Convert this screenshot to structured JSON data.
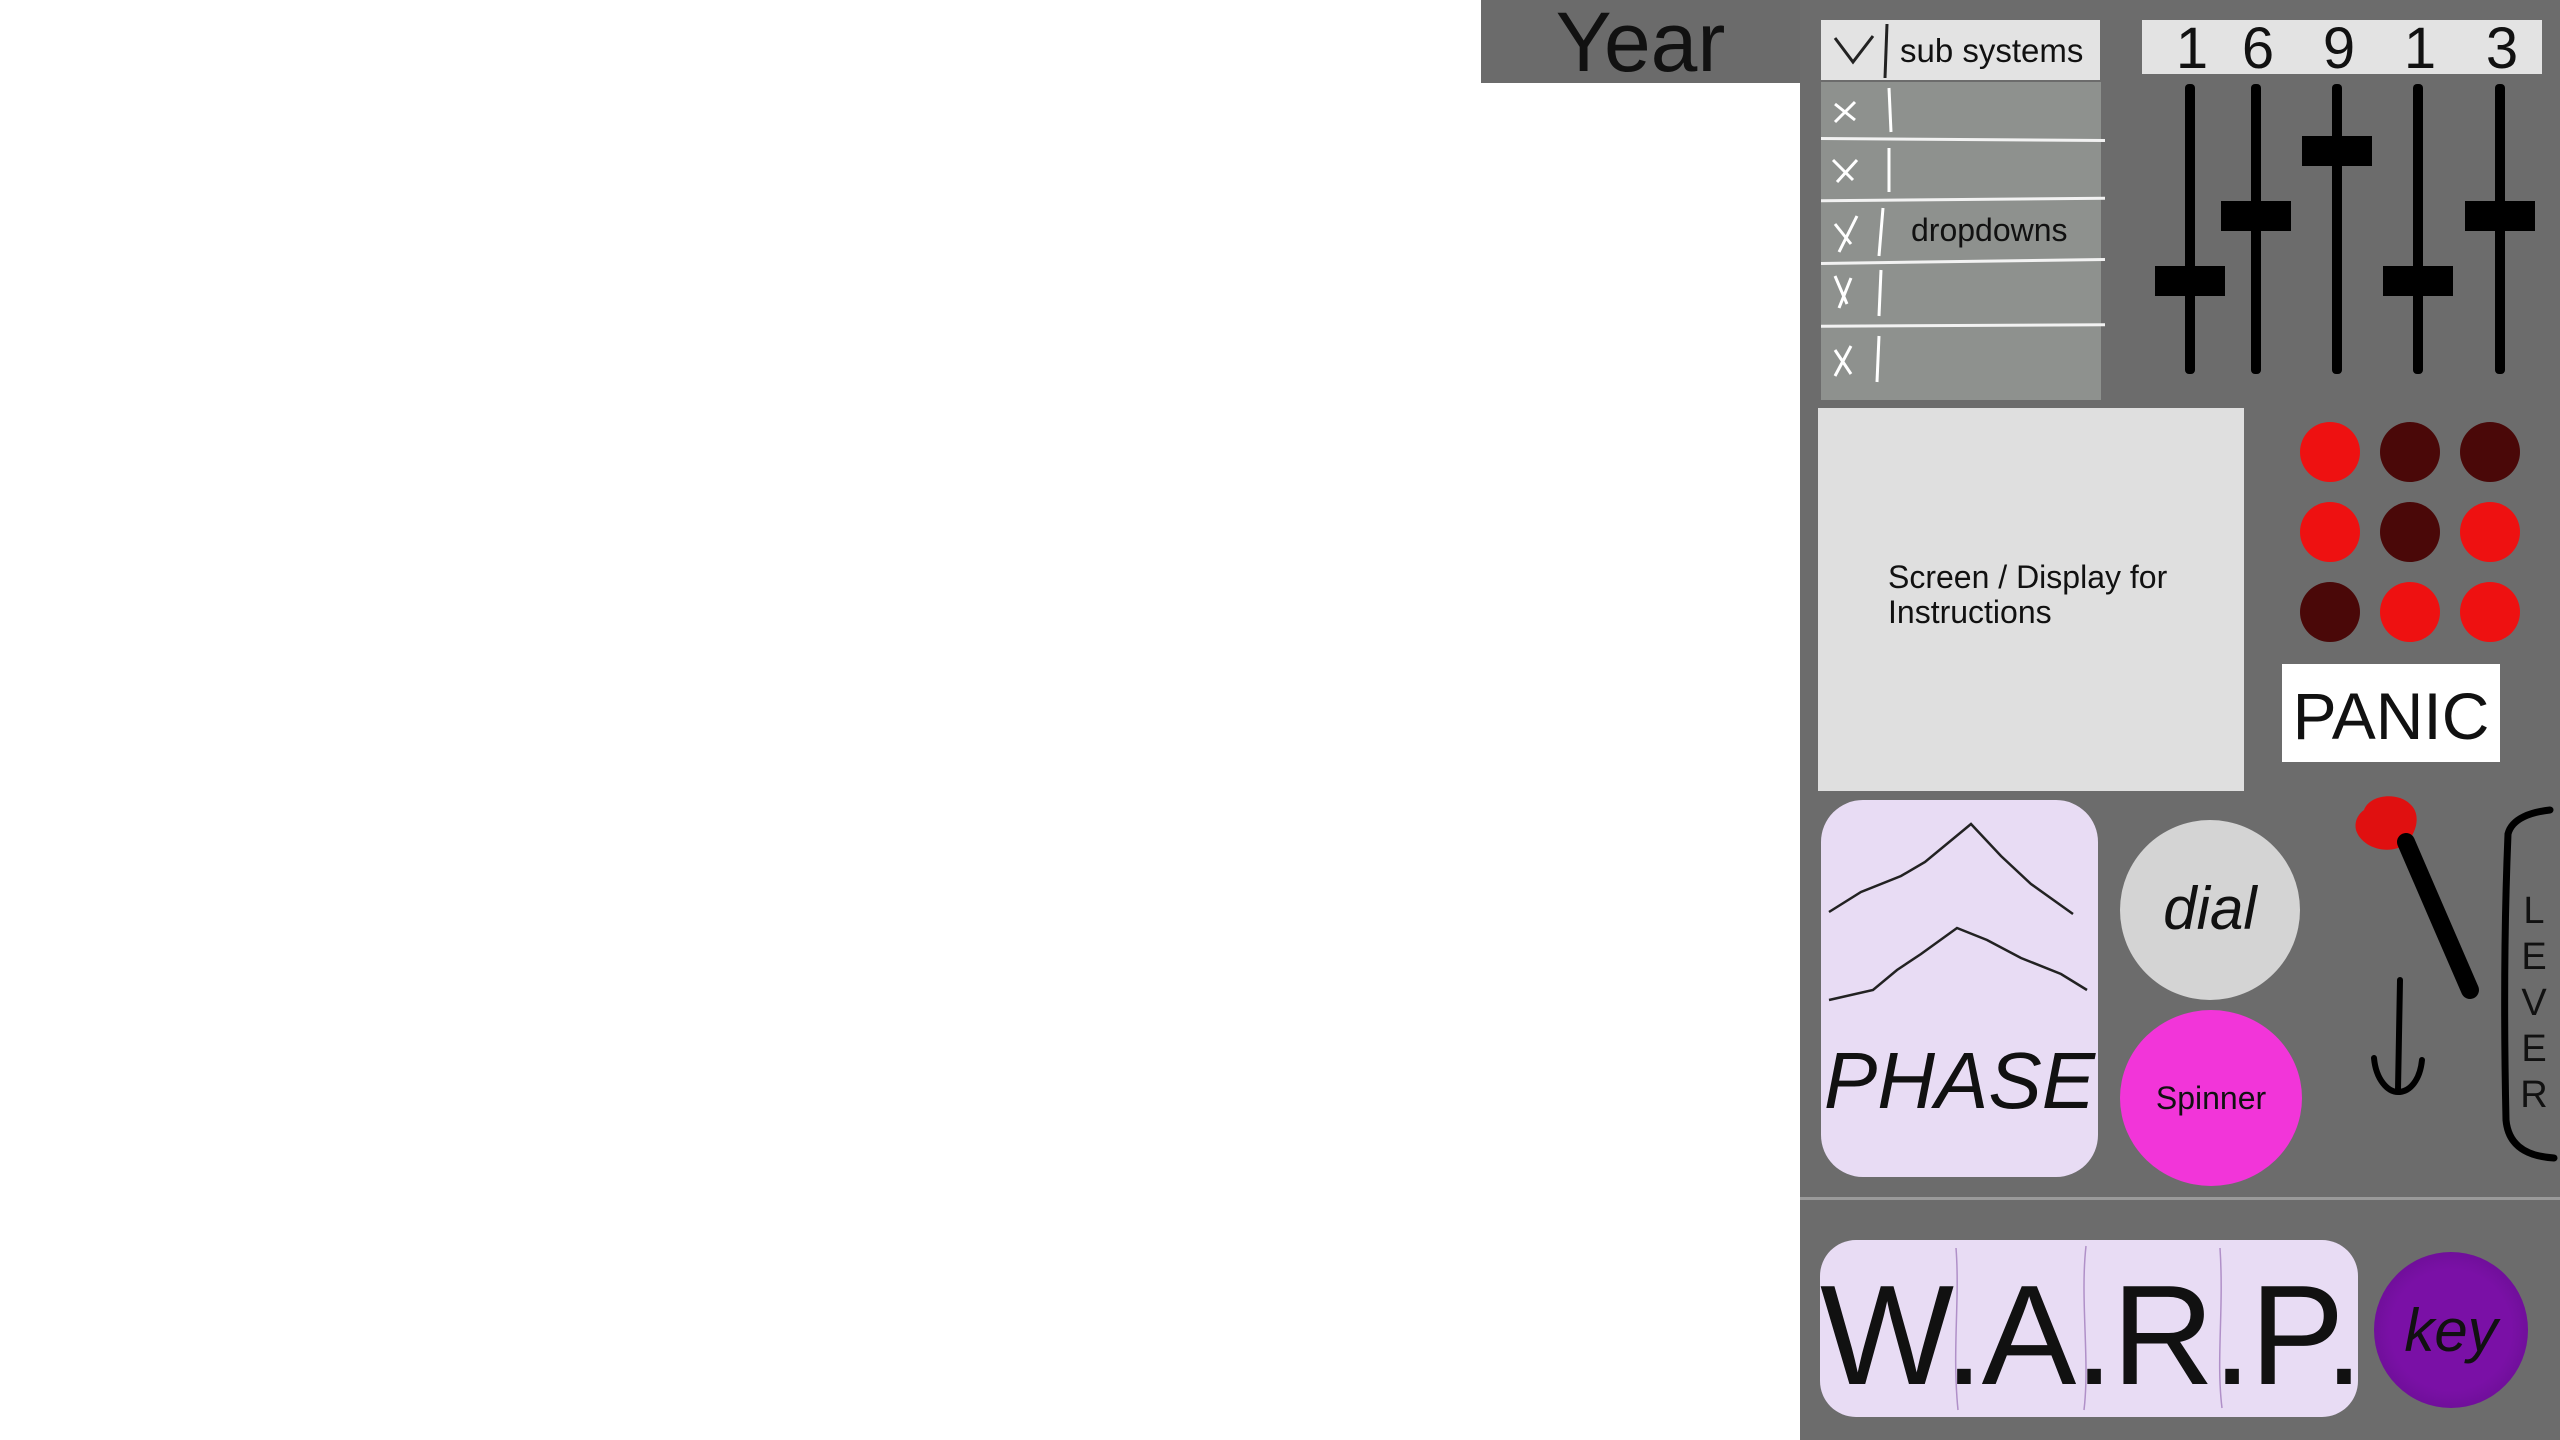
{
  "header": {
    "year_label": "Year"
  },
  "subsystems": {
    "title": "sub systems",
    "dropdowns_label": "dropdowns",
    "rows": 5
  },
  "sliders": {
    "numbers": [
      "1",
      "6",
      "9",
      "1",
      "3"
    ],
    "levels": [
      0.3,
      0.55,
      0.8,
      0.3,
      0.55
    ]
  },
  "screen": {
    "text": "Screen / Display for Instructions"
  },
  "lights": {
    "states": [
      true,
      false,
      false,
      true,
      false,
      true,
      false,
      true,
      true
    ],
    "on_color": "#ee1111",
    "off_color": "#4a0808"
  },
  "panic": {
    "label": "PANIC"
  },
  "phase": {
    "label": "PHASE"
  },
  "dial": {
    "label": "dial"
  },
  "spinner": {
    "label": "Spinner",
    "color": "#f235d9"
  },
  "lever": {
    "label": "LEVER"
  },
  "warp": {
    "label": "W.A.R.P."
  },
  "key": {
    "label": "key",
    "color": "#7a10a6"
  }
}
